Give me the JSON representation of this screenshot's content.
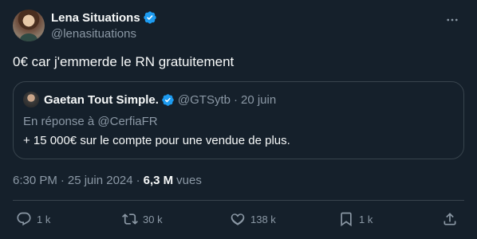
{
  "author": {
    "display_name": "Lena Situations",
    "handle": "@lenasituations"
  },
  "tweet": {
    "text": "0€ car j'emmerde le RN gratuitement"
  },
  "quoted": {
    "display_name": "Gaetan Tout Simple.",
    "handle": "@GTSytb",
    "dot": "·",
    "date": "20 juin",
    "reply_to": "En réponse à @CerfiaFR",
    "text": "+ 15 000€ sur le compte pour une vendue de plus."
  },
  "meta": {
    "time": "6:30 PM",
    "sep1": "·",
    "date": "25 juin 2024",
    "sep2": "·",
    "views_count": "6,3 M",
    "views_label": "vues"
  },
  "actions": {
    "replies": "1 k",
    "retweets": "30 k",
    "likes": "138 k",
    "bookmarks": "1 k"
  },
  "colors": {
    "background": "#15202b",
    "verified": "#1d9bf0",
    "muted": "#8b98a5",
    "border": "#38444d"
  }
}
